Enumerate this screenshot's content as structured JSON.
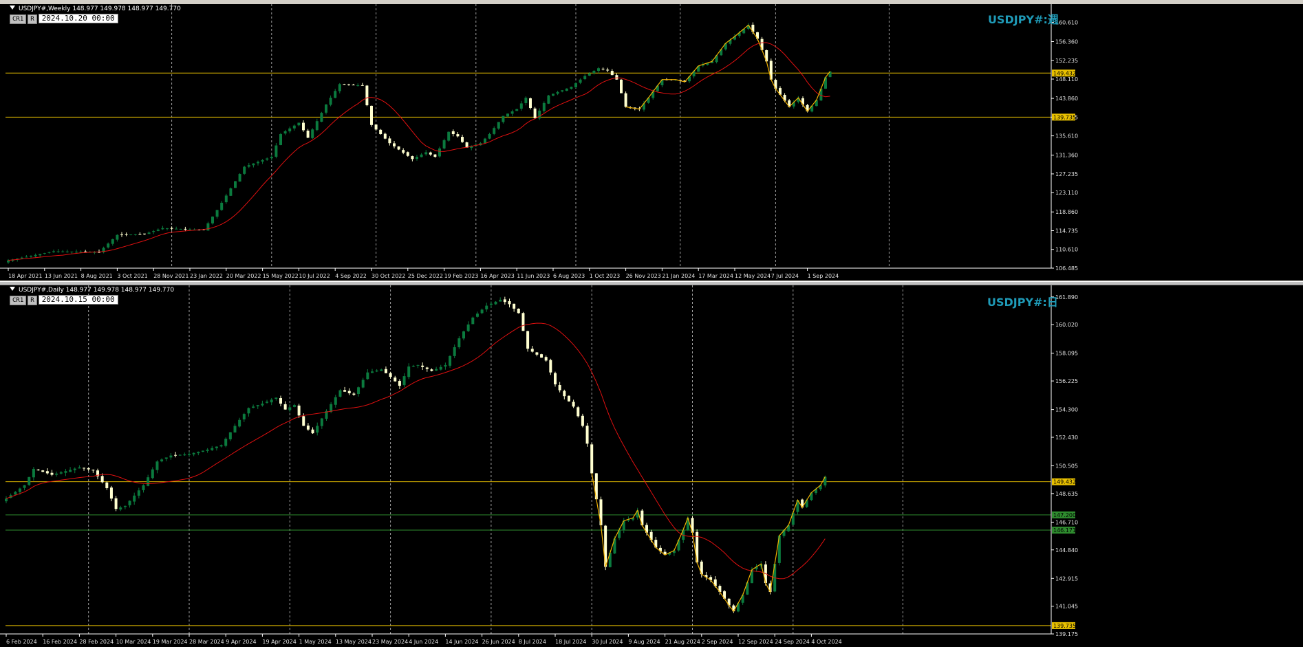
{
  "panes": [
    {
      "id": "weekly",
      "header": "USDJPY#,Weekly  148.977 149.978 148.977 149.770",
      "cr_label": "CR1",
      "r_label": "R",
      "datetime": "2024.10.20 00:00",
      "watermark": "USDJPY#:週",
      "hlines": [
        {
          "value": 149.432,
          "label": "149.432",
          "color": "#e8c000"
        },
        {
          "value": 139.735,
          "label": "139.735",
          "color": "#e8c000"
        }
      ]
    },
    {
      "id": "daily",
      "header": "USDJPY#,Daily  148.977 149.978 148.977 149.770",
      "cr_label": "CR1",
      "r_label": "R",
      "datetime": "2024.10.15 00:00",
      "watermark": "USDJPY#:日",
      "hlines": [
        {
          "value": 149.432,
          "label": "149.432",
          "color": "#e8c000"
        },
        {
          "value": 147.2,
          "label": "147.200",
          "color": "#2e8b2e"
        },
        {
          "value": 146.171,
          "label": "146.171",
          "color": "#2e8b2e"
        },
        {
          "value": 139.735,
          "label": "139.735",
          "color": "#e8c000"
        }
      ]
    }
  ],
  "chart_data": [
    {
      "type": "candlestick",
      "title": "USDJPY#,Weekly",
      "ylim": [
        106.485,
        163.4
      ],
      "y_ticks": [
        "160.610",
        "156.360",
        "152.235",
        "148.110",
        "143.860",
        "139.735",
        "135.610",
        "131.360",
        "127.235",
        "123.110",
        "118.860",
        "114.735",
        "110.610",
        "106.485"
      ],
      "x_ticks": [
        "18 Apr 2021",
        "13 Jun 2021",
        "8 Aug 2021",
        "3 Oct 2021",
        "28 Nov 2021",
        "23 Jan 2022",
        "20 Mar 2022",
        "15 May 2022",
        "10 Jul 2022",
        "4 Sep 2022",
        "30 Oct 2022",
        "25 Dec 2022",
        "19 Feb 2023",
        "16 Apr 2023",
        "11 Jun 2023",
        "6 Aug 2023",
        "1 Oct 2023",
        "26 Nov 2023",
        "21 Jan 2024",
        "17 Mar 2024",
        "12 May 2024",
        "7 Jul 2024",
        "1 Sep 2024"
      ],
      "x_tick_index": [
        0,
        8,
        16,
        24,
        32,
        40,
        48,
        56,
        64,
        72,
        80,
        88,
        96,
        104,
        112,
        120,
        128,
        136,
        144,
        152,
        160,
        168,
        176
      ],
      "anchors": [
        [
          0,
          108.2
        ],
        [
          10,
          110.2
        ],
        [
          20,
          110.0
        ],
        [
          24,
          113.8
        ],
        [
          30,
          114.0
        ],
        [
          34,
          115.3
        ],
        [
          43,
          114.9
        ],
        [
          46,
          119.3
        ],
        [
          52,
          128.8
        ],
        [
          58,
          131.0
        ],
        [
          60,
          136.0
        ],
        [
          64,
          138.5
        ],
        [
          66,
          135.2
        ],
        [
          70,
          142.5
        ],
        [
          73,
          147.0
        ],
        [
          78,
          146.7
        ],
        [
          80,
          138.0
        ],
        [
          84,
          134.0
        ],
        [
          89,
          130.5
        ],
        [
          92,
          132.0
        ],
        [
          94,
          131.0
        ],
        [
          97,
          136.5
        ],
        [
          99,
          135.5
        ],
        [
          101,
          133.0
        ],
        [
          104,
          134.0
        ],
        [
          106,
          136.0
        ],
        [
          109,
          140.0
        ],
        [
          112,
          141.5
        ],
        [
          114,
          144.0
        ],
        [
          116,
          139.5
        ],
        [
          119,
          144.5
        ],
        [
          124,
          146.4
        ],
        [
          127,
          148.8
        ],
        [
          130,
          150.5
        ],
        [
          132,
          150.0
        ],
        [
          134,
          148.0
        ],
        [
          136,
          142.0
        ],
        [
          139,
          141.5
        ],
        [
          141,
          144.0
        ],
        [
          144,
          148.0
        ],
        [
          147,
          148.0
        ],
        [
          149,
          147.5
        ],
        [
          152,
          151.0
        ],
        [
          155,
          152.0
        ],
        [
          158,
          156.0
        ],
        [
          160,
          157.5
        ],
        [
          163,
          160.0
        ],
        [
          165,
          157.0
        ],
        [
          167,
          152.0
        ],
        [
          168,
          148.0
        ],
        [
          169,
          146.0
        ],
        [
          172,
          142.0
        ],
        [
          174,
          144.0
        ],
        [
          176,
          141.0
        ],
        [
          178,
          143.5
        ],
        [
          180,
          148.5
        ],
        [
          181,
          149.77
        ]
      ],
      "ma_color": "#e01010",
      "zigzag_color": "#f0b000"
    },
    {
      "type": "candlestick",
      "title": "USDJPY#,Daily",
      "ylim": [
        139.175,
        162.3
      ],
      "y_ticks": [
        "161.890",
        "160.020",
        "158.095",
        "156.225",
        "154.300",
        "152.430",
        "150.505",
        "148.635",
        "146.710",
        "144.840",
        "142.915",
        "141.045",
        "139.175"
      ],
      "x_ticks": [
        "6 Feb 2024",
        "16 Feb 2024",
        "28 Feb 2024",
        "10 Mar 2024",
        "19 Mar 2024",
        "28 Mar 2024",
        "9 Apr 2024",
        "19 Apr 2024",
        "1 May 2024",
        "13 May 2024",
        "23 May 2024",
        "4 Jun 2024",
        "14 Jun 2024",
        "26 Jun 2024",
        "8 Jul 2024",
        "18 Jul 2024",
        "30 Jul 2024",
        "9 Aug 2024",
        "21 Aug 2024",
        "2 Sep 2024",
        "12 Sep 2024",
        "24 Sep 2024",
        "4 Oct 2024"
      ],
      "x_tick_index": [
        0,
        8,
        16,
        24,
        32,
        40,
        48,
        56,
        64,
        72,
        80,
        88,
        96,
        104,
        112,
        120,
        128,
        136,
        144,
        152,
        160,
        168,
        176
      ],
      "anchors": [
        [
          0,
          148.3
        ],
        [
          4,
          149.2
        ],
        [
          6,
          150.3
        ],
        [
          10,
          149.9
        ],
        [
          16,
          150.4
        ],
        [
          19,
          150.2
        ],
        [
          22,
          149.0
        ],
        [
          24,
          147.6
        ],
        [
          26,
          147.8
        ],
        [
          30,
          149.2
        ],
        [
          33,
          150.8
        ],
        [
          36,
          151.2
        ],
        [
          40,
          151.3
        ],
        [
          44,
          151.6
        ],
        [
          47,
          151.9
        ],
        [
          50,
          153.2
        ],
        [
          53,
          154.4
        ],
        [
          56,
          154.7
        ],
        [
          59,
          155.1
        ],
        [
          61,
          154.3
        ],
        [
          63,
          154.6
        ],
        [
          65,
          153.2
        ],
        [
          67,
          152.7
        ],
        [
          70,
          154.2
        ],
        [
          73,
          155.6
        ],
        [
          76,
          155.3
        ],
        [
          79,
          156.8
        ],
        [
          82,
          157.0
        ],
        [
          84,
          156.5
        ],
        [
          86,
          155.9
        ],
        [
          88,
          157.2
        ],
        [
          90,
          157.3
        ],
        [
          93,
          156.9
        ],
        [
          96,
          157.3
        ],
        [
          99,
          159.1
        ],
        [
          102,
          160.5
        ],
        [
          105,
          161.3
        ],
        [
          108,
          161.7
        ],
        [
          110,
          161.4
        ],
        [
          112,
          160.8
        ],
        [
          114,
          158.4
        ],
        [
          116,
          158.0
        ],
        [
          118,
          157.6
        ],
        [
          120,
          156.0
        ],
        [
          122,
          155.2
        ],
        [
          124,
          154.5
        ],
        [
          126,
          153.2
        ],
        [
          127,
          152.0
        ],
        [
          128,
          150.0
        ],
        [
          130,
          146.5
        ],
        [
          131,
          143.7
        ],
        [
          133,
          145.6
        ],
        [
          135,
          146.8
        ],
        [
          137,
          147.0
        ],
        [
          138,
          147.5
        ],
        [
          139,
          146.5
        ],
        [
          140,
          146.0
        ],
        [
          142,
          145.0
        ],
        [
          144,
          144.5
        ],
        [
          146,
          144.8
        ],
        [
          148,
          146.2
        ],
        [
          149,
          147.0
        ],
        [
          150,
          146.0
        ],
        [
          151,
          144.0
        ],
        [
          152,
          143.2
        ],
        [
          154,
          142.8
        ],
        [
          156,
          142.0
        ],
        [
          158,
          141.1
        ],
        [
          159,
          140.7
        ],
        [
          161,
          141.8
        ],
        [
          163,
          143.5
        ],
        [
          165,
          143.9
        ],
        [
          166,
          142.6
        ],
        [
          167,
          142.0
        ],
        [
          169,
          145.8
        ],
        [
          171,
          146.5
        ],
        [
          173,
          148.2
        ],
        [
          174,
          147.7
        ],
        [
          176,
          148.7
        ],
        [
          178,
          149.2
        ],
        [
          179,
          149.77
        ]
      ],
      "ma_color": "#e01010",
      "zigzag_color": "#f0b000"
    }
  ],
  "colors": {
    "background": "#000000",
    "bull": "#0b7a3e",
    "bear": "#ffffd0",
    "grid": "#c8c8c8",
    "axis_text": "#e0e0e0",
    "watermark": "#1f9bb8"
  }
}
